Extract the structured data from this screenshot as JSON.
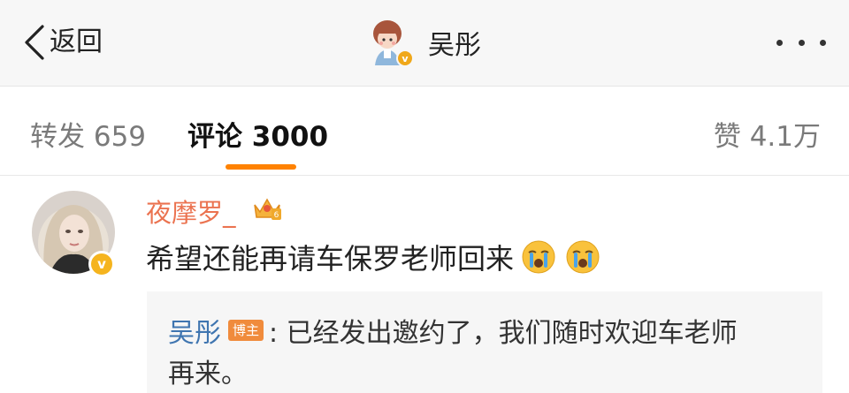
{
  "nav": {
    "back_label": "返回",
    "title": "吴彤",
    "avatar_badge": "v"
  },
  "tabs": {
    "repost": "转发 659",
    "comments": "评论 3000",
    "likes": "赞 4.1万"
  },
  "comment": {
    "username": "夜摩罗_",
    "avatar_badge": "v",
    "text": "希望还能再请车保罗老师回来",
    "emojis": [
      "crying-face-icon",
      "crying-face-icon"
    ]
  },
  "reply": {
    "author": "吴彤",
    "tag": "博主",
    "text_line1": ": 已经发出邀约了，我们随时欢迎车老师",
    "text_line2": "再来。"
  },
  "colors": {
    "accent": "#ff8200",
    "username": "#eb7350",
    "reply_author": "#3f75b0",
    "host_tag": "#f08b3c",
    "verified_badge": "#f5b41e"
  }
}
